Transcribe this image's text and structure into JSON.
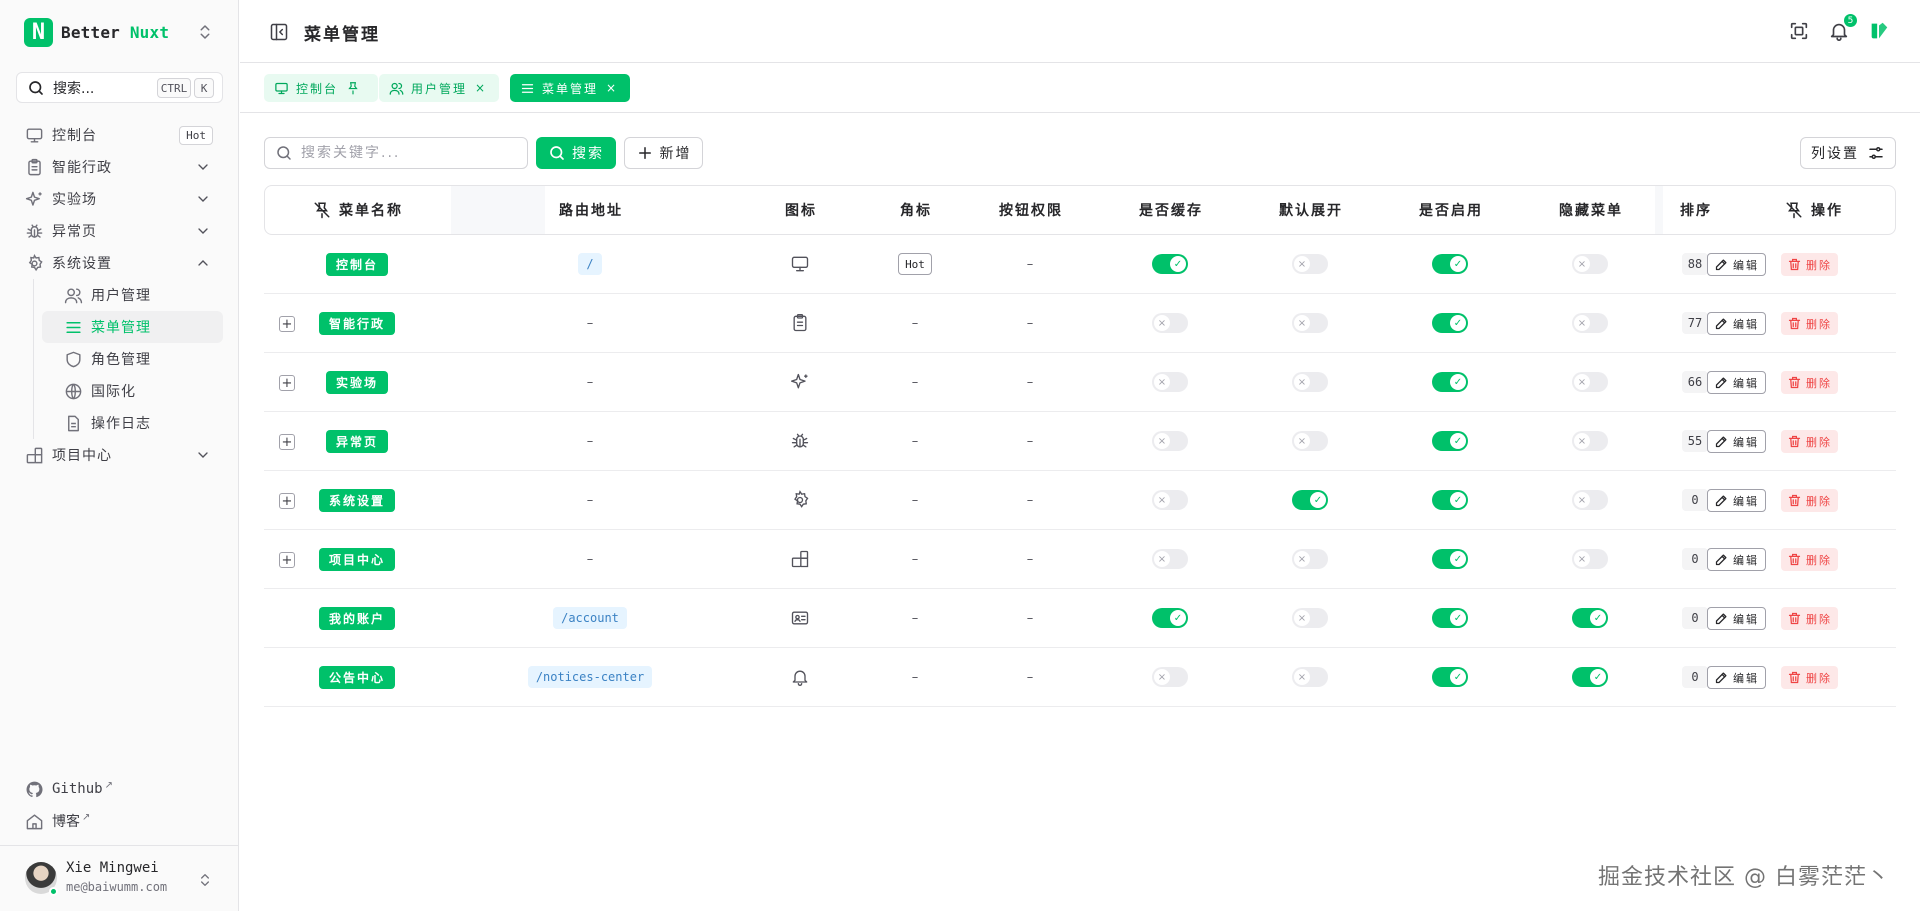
{
  "brand": {
    "prefix": "Better",
    "accent": "Nuxt",
    "logo_letter": "N"
  },
  "sidebar": {
    "search_label": "搜索...",
    "kbd_ctrl": "CTRL",
    "kbd_k": "K",
    "items": [
      {
        "label": "控制台",
        "icon": "monitor-icon",
        "badge": "Hot"
      },
      {
        "label": "智能行政",
        "icon": "clipboard-icon",
        "chevron": "down"
      },
      {
        "label": "实验场",
        "icon": "sparkles-icon",
        "chevron": "down"
      },
      {
        "label": "异常页",
        "icon": "bug-icon",
        "chevron": "down"
      },
      {
        "label": "系统设置",
        "icon": "gear-icon",
        "chevron": "up",
        "children": [
          {
            "label": "用户管理",
            "icon": "users-icon"
          },
          {
            "label": "菜单管理",
            "icon": "menu-icon",
            "active": true
          },
          {
            "label": "角色管理",
            "icon": "shield-icon"
          },
          {
            "label": "国际化",
            "icon": "globe-icon"
          },
          {
            "label": "操作日志",
            "icon": "file-text-icon"
          }
        ]
      },
      {
        "label": "项目中心",
        "icon": "blocks-icon",
        "chevron": "down"
      }
    ],
    "footer_links": [
      {
        "label": "Github",
        "icon": "github-icon",
        "ext": "↗"
      },
      {
        "label": "博客",
        "icon": "home-icon",
        "ext": "↗"
      }
    ],
    "user": {
      "name": "Xie Mingwei",
      "email": "me@baiwumm.com"
    }
  },
  "header": {
    "title": "菜单管理",
    "notification_count": "5"
  },
  "tabs": [
    {
      "label": "控制台",
      "icon": "monitor-icon",
      "pinned": true
    },
    {
      "label": "用户管理",
      "icon": "users-icon",
      "close": "×"
    },
    {
      "label": "菜单管理",
      "icon": "menu-icon",
      "close": "×",
      "active": true
    }
  ],
  "toolbar": {
    "search_placeholder": "搜索关键字...",
    "search_button": "搜索",
    "add_button": "新增",
    "column_settings": "列设置"
  },
  "table": {
    "columns": [
      "菜单名称",
      "路由地址",
      "图标",
      "角标",
      "按钮权限",
      "是否缓存",
      "默认展开",
      "是否启用",
      "隐藏菜单",
      "排序",
      "操作"
    ],
    "edit_label": "编辑",
    "delete_label": "删除",
    "rows": [
      {
        "name": "控制台",
        "expandable": false,
        "path": "/",
        "icon": "monitor-icon",
        "badge": "Hot",
        "perm": "–",
        "cache": true,
        "expand": false,
        "enabled": true,
        "hidden": false,
        "sort": "88"
      },
      {
        "name": "智能行政",
        "expandable": true,
        "path": "–",
        "icon": "clipboard-icon",
        "badge": "–",
        "perm": "–",
        "cache": false,
        "expand": false,
        "enabled": true,
        "hidden": false,
        "sort": "77"
      },
      {
        "name": "实验场",
        "expandable": true,
        "path": "–",
        "icon": "sparkles-icon",
        "badge": "–",
        "perm": "–",
        "cache": false,
        "expand": false,
        "enabled": true,
        "hidden": false,
        "sort": "66"
      },
      {
        "name": "异常页",
        "expandable": true,
        "path": "–",
        "icon": "bug-icon",
        "badge": "–",
        "perm": "–",
        "cache": false,
        "expand": false,
        "enabled": true,
        "hidden": false,
        "sort": "55"
      },
      {
        "name": "系统设置",
        "expandable": true,
        "path": "–",
        "icon": "gear-icon",
        "badge": "–",
        "perm": "–",
        "cache": false,
        "expand": true,
        "enabled": true,
        "hidden": false,
        "sort": "0"
      },
      {
        "name": "项目中心",
        "expandable": true,
        "path": "–",
        "icon": "blocks-icon",
        "badge": "–",
        "perm": "–",
        "cache": false,
        "expand": false,
        "enabled": true,
        "hidden": false,
        "sort": "0"
      },
      {
        "name": "我的账户",
        "expandable": false,
        "path": "/account",
        "icon": "id-card-icon",
        "badge": "–",
        "perm": "–",
        "cache": true,
        "expand": false,
        "enabled": true,
        "hidden": true,
        "sort": "0"
      },
      {
        "name": "公告中心",
        "expandable": false,
        "path": "/notices-center",
        "icon": "bell-icon",
        "badge": "–",
        "perm": "–",
        "cache": false,
        "expand": false,
        "enabled": true,
        "hidden": true,
        "sort": "0"
      }
    ]
  },
  "watermark": "掘金技术社区 @ 白雾茫茫丶",
  "colors": {
    "primary": "#00c16a",
    "danger": "#ef4444",
    "path_text": "#3b82c4"
  }
}
